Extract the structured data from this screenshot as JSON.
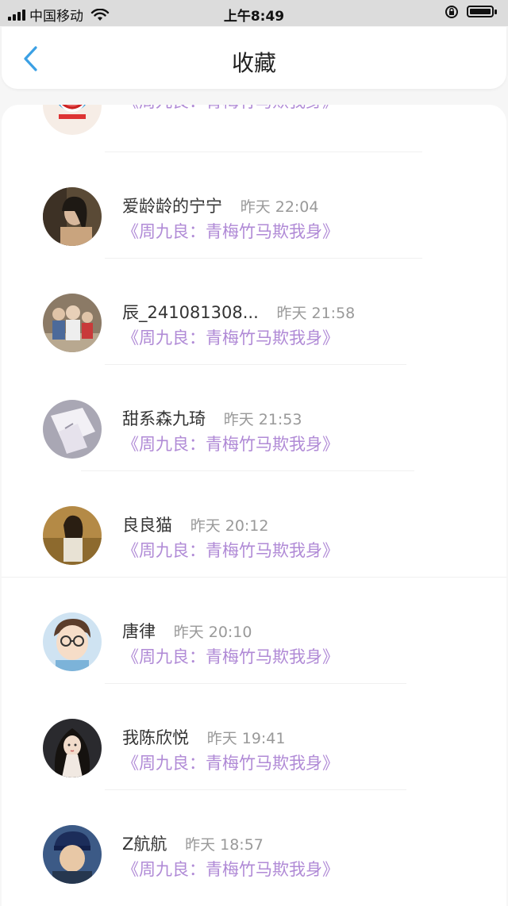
{
  "status_bar": {
    "carrier": "中国移动",
    "time": "上午8:49"
  },
  "nav": {
    "title": "收藏"
  },
  "colors": {
    "accent": "#3ba0e4",
    "link_purple": "#b08ad6",
    "time_gray": "#999999"
  },
  "favorites": [
    {
      "name": "",
      "time": "",
      "text": "《周九良：青梅竹马欺我身》",
      "avatar": "doraemon-avatar"
    },
    {
      "name": "爱龄龄的宁宁",
      "time": "昨天 22:04",
      "text": "《周九良：青梅竹马欺我身》",
      "avatar": "girl-photo-avatar"
    },
    {
      "name": "辰_241081308...",
      "time": "昨天 21:58",
      "text": "《周九良：青梅竹马欺我身》",
      "avatar": "family-photo-avatar"
    },
    {
      "name": "甜系森九琦",
      "time": "昨天 21:53",
      "text": "《周九良：青梅竹马欺我身》",
      "avatar": "hand-photo-avatar"
    },
    {
      "name": "良良猫",
      "time": "昨天 20:12",
      "text": "《周九良：青梅竹马欺我身》",
      "avatar": "autumn-girl-avatar"
    },
    {
      "name": "唐律",
      "time": "昨天 20:10",
      "text": "《周九良：青梅竹马欺我身》",
      "avatar": "cartoon-boy-avatar"
    },
    {
      "name": "我陈欣悦",
      "time": "昨天 19:41",
      "text": "《周九良：青梅竹马欺我身》",
      "avatar": "drawn-girl-avatar"
    },
    {
      "name": "Z航航",
      "time": "昨天 18:57",
      "text": "《周九良：青梅竹马欺我身》",
      "avatar": "cap-man-avatar"
    }
  ]
}
